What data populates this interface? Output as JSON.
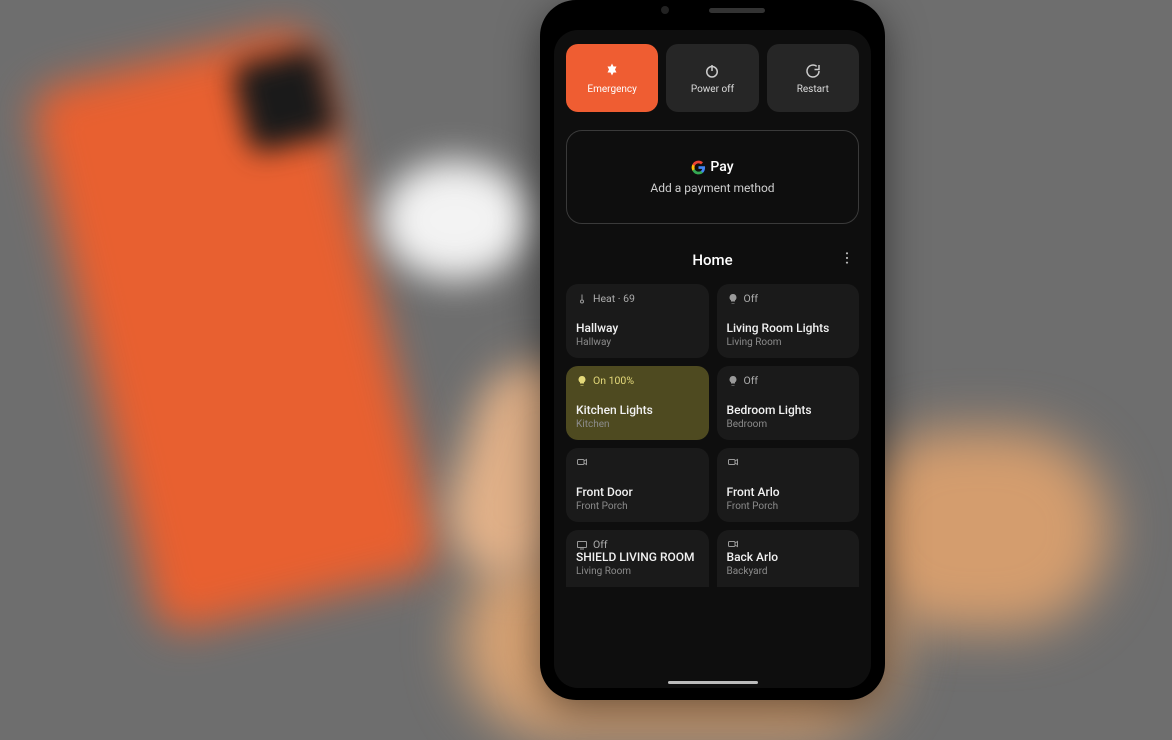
{
  "power": {
    "emergency": "Emergency",
    "poweroff": "Power off",
    "restart": "Restart"
  },
  "pay": {
    "brand": "Pay",
    "subtitle": "Add a payment method"
  },
  "section": {
    "title": "Home"
  },
  "devices": [
    {
      "status": "Heat · 69",
      "name": "Hallway",
      "room": "Hallway",
      "icon": "thermostat",
      "active": false
    },
    {
      "status": "Off",
      "name": "Living Room Lights",
      "room": "Living Room",
      "icon": "bulb",
      "active": false
    },
    {
      "status": "On 100%",
      "name": "Kitchen Lights",
      "room": "Kitchen",
      "icon": "bulb",
      "active": true
    },
    {
      "status": "Off",
      "name": "Bedroom Lights",
      "room": "Bedroom",
      "icon": "bulb",
      "active": false
    },
    {
      "status": "",
      "name": "Front Door",
      "room": "Front Porch",
      "icon": "camera",
      "active": false
    },
    {
      "status": "",
      "name": "Front Arlo",
      "room": "Front Porch",
      "icon": "camera",
      "active": false
    },
    {
      "status": "Off",
      "name": "SHIELD LIVING ROOM",
      "room": "Living Room",
      "icon": "tv",
      "active": false
    },
    {
      "status": "",
      "name": "Back Arlo",
      "room": "Backyard",
      "icon": "camera",
      "active": false
    }
  ]
}
